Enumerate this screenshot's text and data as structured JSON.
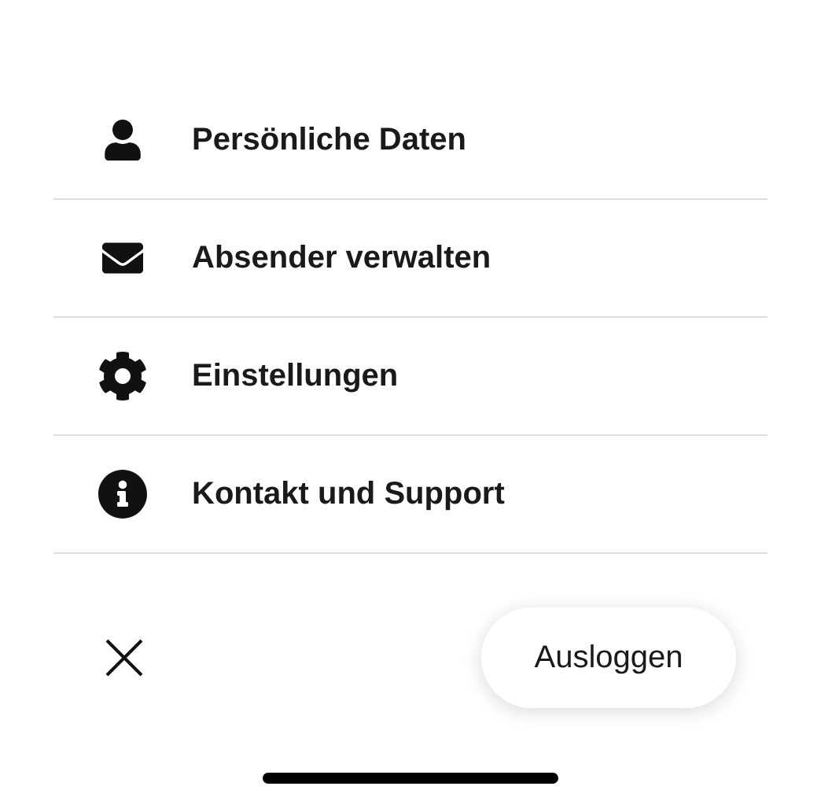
{
  "menu": [
    {
      "kind": "person",
      "label": "Persönliche Daten"
    },
    {
      "kind": "mail",
      "label": "Absender verwalten"
    },
    {
      "kind": "gear",
      "label": "Einstellungen"
    },
    {
      "kind": "info",
      "label": "Kontakt und Support"
    }
  ],
  "logout_button": "Ausloggen"
}
